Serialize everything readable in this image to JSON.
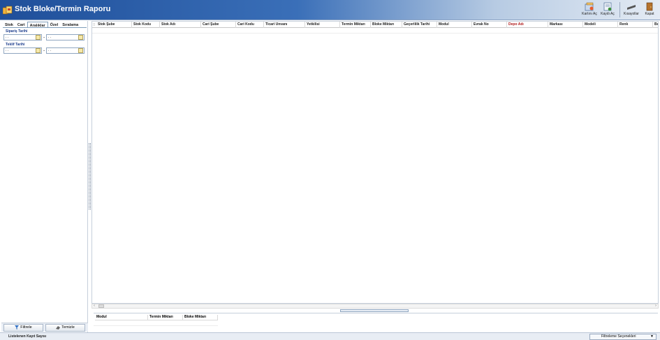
{
  "window": {
    "title": "Stok Bloke/Termin Raporu"
  },
  "toolbar": {
    "buttons": [
      {
        "label": "Kartını Aç",
        "icon": "open-card-icon"
      },
      {
        "label": "Kaydı Aç",
        "icon": "open-record-icon"
      },
      {
        "label": "Kısayollar",
        "icon": "shortcuts-icon"
      },
      {
        "label": "Kapat",
        "icon": "exit-door-icon"
      }
    ]
  },
  "filters": {
    "tabs": [
      "Stok",
      "Cari",
      "Aralıklar",
      "Özel",
      "Sıralama"
    ],
    "active_tab": "Aralıklar",
    "ranges": [
      {
        "label": "Sipariş Tarihi",
        "from": ". .",
        "to": ". ."
      },
      {
        "label": "Teklif Tarihi",
        "from": ". .",
        "to": ". ."
      }
    ],
    "filter_button": "Filtrele",
    "clear_button": "Temizle"
  },
  "grid": {
    "row_selector": "⁝⁝",
    "columns": [
      "Stok Şube",
      "Stok Kodu",
      "Stok Adı",
      "Cari Şube",
      "Cari Kodu",
      "Ticari Unvanı",
      "Yetkilisi",
      "Termin Miktarı",
      "Bloke Miktarı",
      "Geçerlilik Tarihi",
      "Modul",
      "Evrak No",
      "Depo Adı",
      "Markası",
      "Modeli",
      "Renk",
      "Be"
    ]
  },
  "detail_grid": {
    "columns": [
      "Modul",
      "Termin Miktarı",
      "Bloke Miktarı"
    ]
  },
  "status": {
    "record_count_label": "Listelenen Kayıt Sayısı",
    "filter_options_label": "Filtreleme Seçenekleri"
  },
  "colors": {
    "title_bar": "#1f4f9a",
    "depo_header": "#b01a1a",
    "filter_label": "#1b3c8c"
  }
}
